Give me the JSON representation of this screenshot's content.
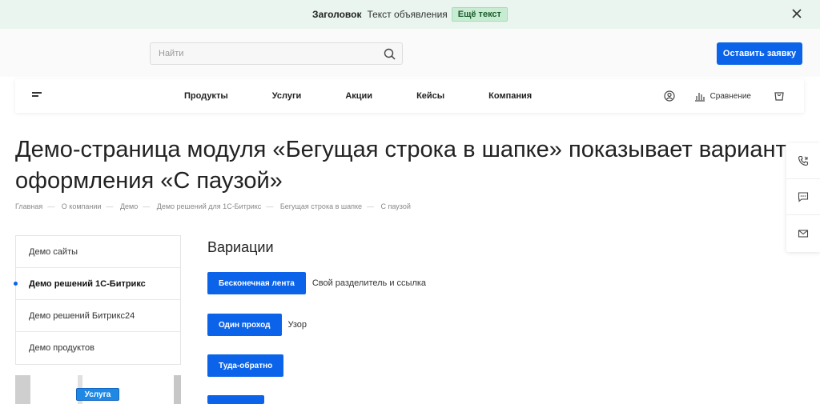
{
  "announcement": {
    "title": "Заголовок",
    "text": "Текст объявления",
    "button": "Ещё текст"
  },
  "header": {
    "search_placeholder": "Найти",
    "cta": "Оставить заявку"
  },
  "nav": {
    "items": [
      "Продукты",
      "Услуги",
      "Акции",
      "Кейсы",
      "Компания"
    ],
    "compare": "Сравнение"
  },
  "page": {
    "title": "Демо-страница модуля «Бегущая строка в шапке» показывает вариант оформления «С паузой»",
    "breadcrumbs": [
      "Главная",
      "О компании",
      "Демо",
      "Демо решений для 1С-Битрикс",
      "Бегущая строка в шапке",
      "С паузой"
    ]
  },
  "sidebar": {
    "items": [
      "Демо сайты",
      "Демо решений 1С-Битрикс",
      "Демо решений Битрикс24",
      "Демо продуктов"
    ],
    "active_index": 1,
    "promo_badge": "Услуга"
  },
  "content": {
    "heading": "Вариации",
    "variations": [
      {
        "label": "Бесконечная лента",
        "desc": "Свой разделитель и ссылка"
      },
      {
        "label": "Один проход",
        "desc": "Узор"
      },
      {
        "label": "Туда-обратно",
        "desc": ""
      }
    ]
  },
  "colors": {
    "accent": "#0a63e8",
    "announce_bg": "#e9f5ee"
  }
}
